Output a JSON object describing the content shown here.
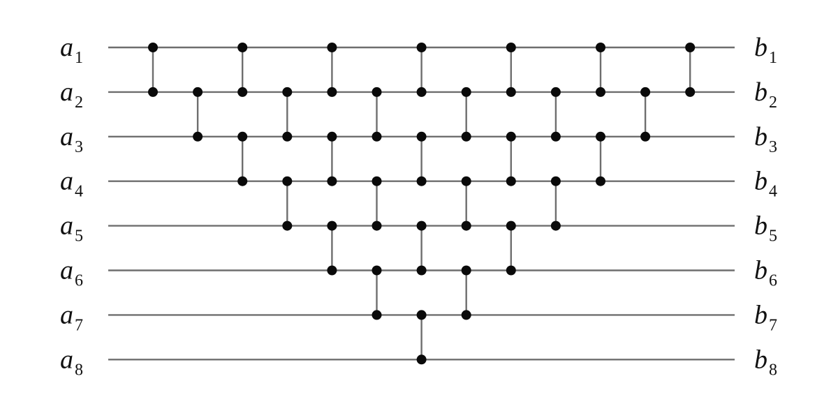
{
  "diagram": {
    "type": "comparator-network",
    "wire_count": 8,
    "input_labels": [
      {
        "base": "a",
        "sub": "1"
      },
      {
        "base": "a",
        "sub": "2"
      },
      {
        "base": "a",
        "sub": "3"
      },
      {
        "base": "a",
        "sub": "4"
      },
      {
        "base": "a",
        "sub": "5"
      },
      {
        "base": "a",
        "sub": "6"
      },
      {
        "base": "a",
        "sub": "7"
      },
      {
        "base": "a",
        "sub": "8"
      }
    ],
    "output_labels": [
      {
        "base": "b",
        "sub": "1"
      },
      {
        "base": "b",
        "sub": "2"
      },
      {
        "base": "b",
        "sub": "3"
      },
      {
        "base": "b",
        "sub": "4"
      },
      {
        "base": "b",
        "sub": "5"
      },
      {
        "base": "b",
        "sub": "6"
      },
      {
        "base": "b",
        "sub": "7"
      },
      {
        "base": "b",
        "sub": "8"
      }
    ],
    "columns": [
      [
        [
          1,
          2
        ]
      ],
      [
        [
          2,
          3
        ]
      ],
      [
        [
          1,
          2
        ],
        [
          3,
          4
        ]
      ],
      [
        [
          2,
          3
        ],
        [
          4,
          5
        ]
      ],
      [
        [
          1,
          2
        ],
        [
          3,
          4
        ],
        [
          5,
          6
        ]
      ],
      [
        [
          2,
          3
        ],
        [
          4,
          5
        ],
        [
          6,
          7
        ]
      ],
      [
        [
          1,
          2
        ],
        [
          3,
          4
        ],
        [
          5,
          6
        ],
        [
          7,
          8
        ]
      ],
      [
        [
          2,
          3
        ],
        [
          4,
          5
        ],
        [
          6,
          7
        ]
      ],
      [
        [
          1,
          2
        ],
        [
          3,
          4
        ],
        [
          5,
          6
        ]
      ],
      [
        [
          2,
          3
        ],
        [
          4,
          5
        ]
      ],
      [
        [
          1,
          2
        ],
        [
          3,
          4
        ]
      ],
      [
        [
          2,
          3
        ]
      ],
      [
        [
          1,
          2
        ]
      ]
    ],
    "colors": {
      "wire": "#6e6e6e",
      "node": "#0a0a0a",
      "label": "#111111",
      "background": "#ffffff"
    }
  }
}
